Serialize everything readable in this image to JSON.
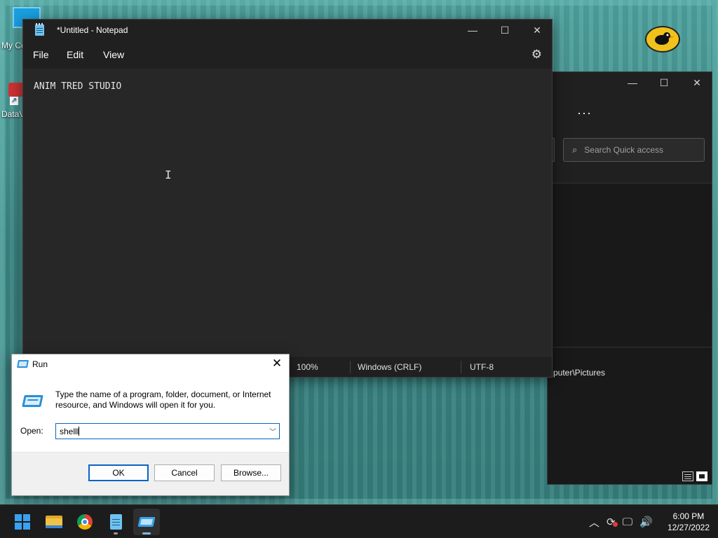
{
  "desktop": {
    "icons": [
      {
        "label": "My Co"
      },
      {
        "label": "DataV"
      }
    ]
  },
  "notepad": {
    "title": "*Untitled - Notepad",
    "menu": [
      "File",
      "Edit",
      "View"
    ],
    "content": "ANIM TRED STUDIO",
    "status": {
      "zoom": "100%",
      "line_endings": "Windows (CRLF)",
      "encoding": "UTF-8"
    }
  },
  "explorer": {
    "more_label": "···",
    "search_placeholder": "Search Quick access",
    "path_fragment": "puter\\Pictures"
  },
  "run_dialog": {
    "title": "Run",
    "description": "Type the name of a program, folder, document, or Internet resource, and Windows will open it for you.",
    "open_label": "Open:",
    "input_value": "shelll",
    "buttons": {
      "ok": "OK",
      "cancel": "Cancel",
      "browse": "Browse..."
    }
  },
  "taskbar": {
    "apps": [
      "start-icon",
      "file-explorer-icon",
      "chrome-icon",
      "notepad-icon",
      "run-icon"
    ],
    "clock": {
      "time": "6:00 PM",
      "date": "12/27/2022"
    }
  },
  "colors": {
    "desktop_teal": "#3e8e8c",
    "dark_window": "#272727",
    "accent_blue": "#0a64c4"
  }
}
